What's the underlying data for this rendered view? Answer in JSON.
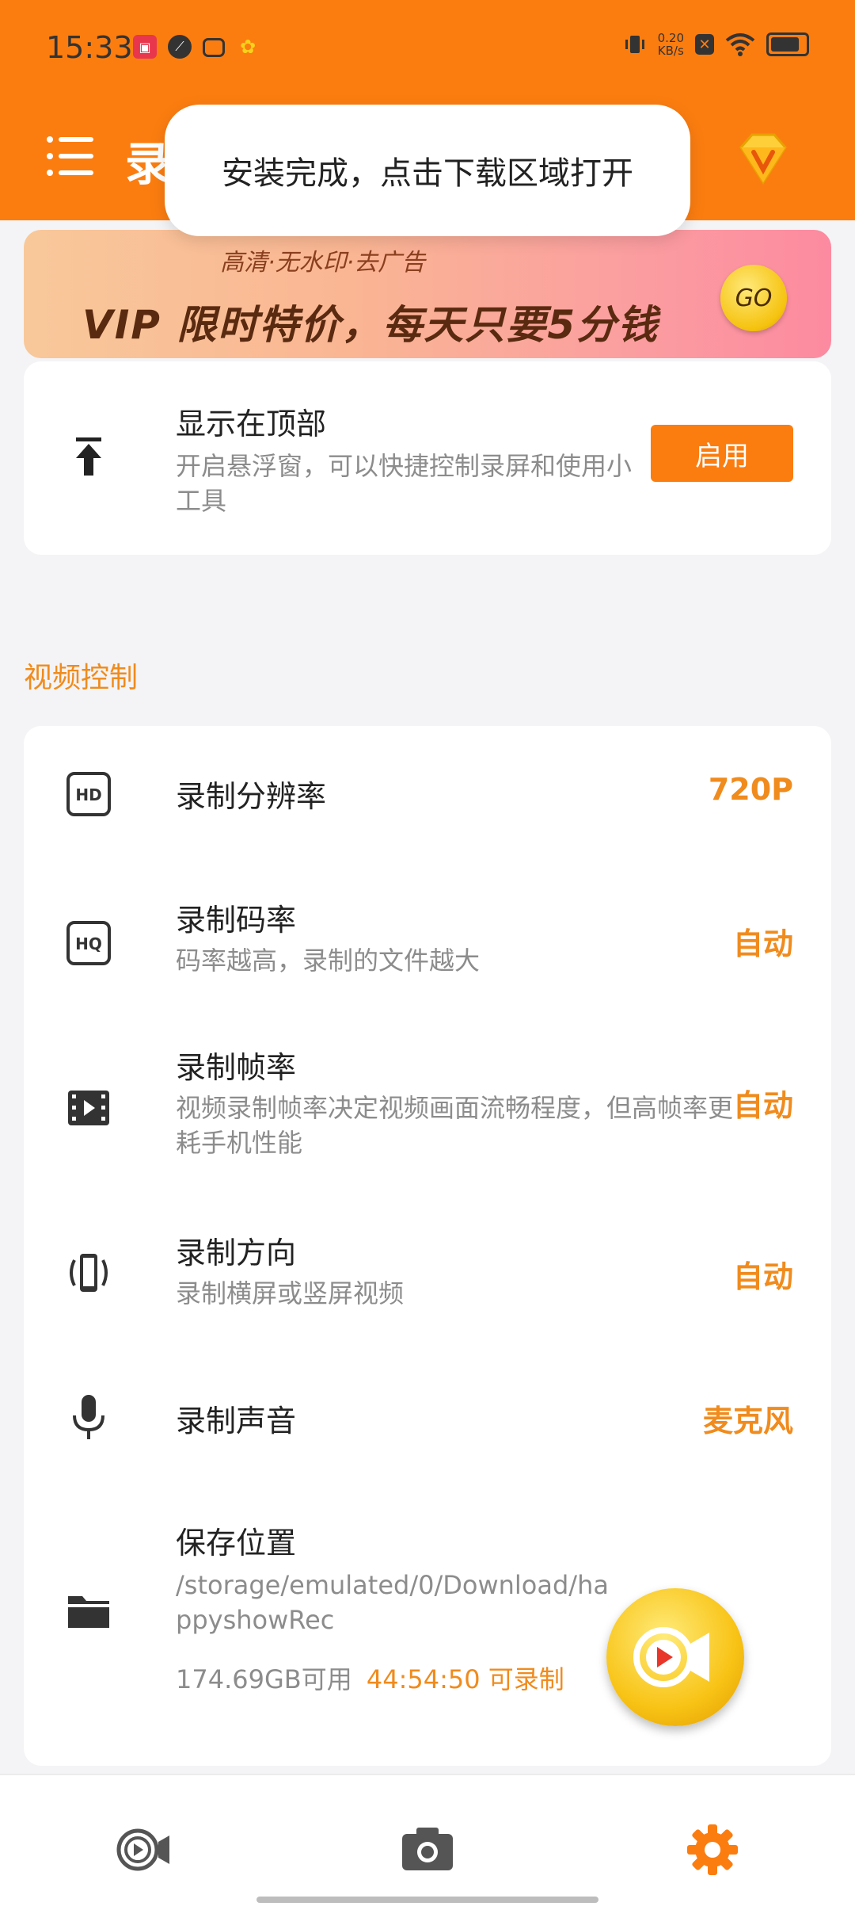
{
  "status": {
    "time": "15:33",
    "net_speed_value": "0.20",
    "net_speed_unit": "KB/s"
  },
  "appbar": {
    "title": "录"
  },
  "toast": {
    "text": "安装完成，点击下载区域打开"
  },
  "banner": {
    "subtitle": "高清·无水印·去广告",
    "headline": "VIP 限时特价，每天只要5分钱",
    "go_label": "GO"
  },
  "top_display": {
    "title": "显示在顶部",
    "desc": "开启悬浮窗，可以快捷控制录屏和使用小工具",
    "button": "启用"
  },
  "section": {
    "title": "视频控制"
  },
  "settings": [
    {
      "title": "录制分辨率",
      "desc": "",
      "value": "720P"
    },
    {
      "title": "录制码率",
      "desc": "码率越高，录制的文件越大",
      "value": "自动"
    },
    {
      "title": "录制帧率",
      "desc": "视频录制帧率决定视频画面流畅程度，但高帧率更耗手机性能",
      "value": "自动"
    },
    {
      "title": "录制方向",
      "desc": "录制横屏或竖屏视频",
      "value": "自动"
    },
    {
      "title": "录制声音",
      "desc": "",
      "value": "麦克风"
    }
  ],
  "save_location": {
    "title": "保存位置",
    "path": "/storage/emulated/0/Download/happyshowRec",
    "available": "174.69GB可用",
    "recordable": "44:54:50 可录制"
  },
  "colors": {
    "primary": "#fb7d10",
    "accent_text": "#f08b1d"
  },
  "icons": [
    "menu-icon",
    "vip-diamond-icon",
    "upload-top-icon",
    "hd-icon",
    "hq-icon",
    "film-icon",
    "phone-rotate-icon",
    "mic-icon",
    "folder-icon",
    "record-fab-icon",
    "nav-record-icon",
    "nav-camera-icon",
    "nav-settings-icon"
  ]
}
